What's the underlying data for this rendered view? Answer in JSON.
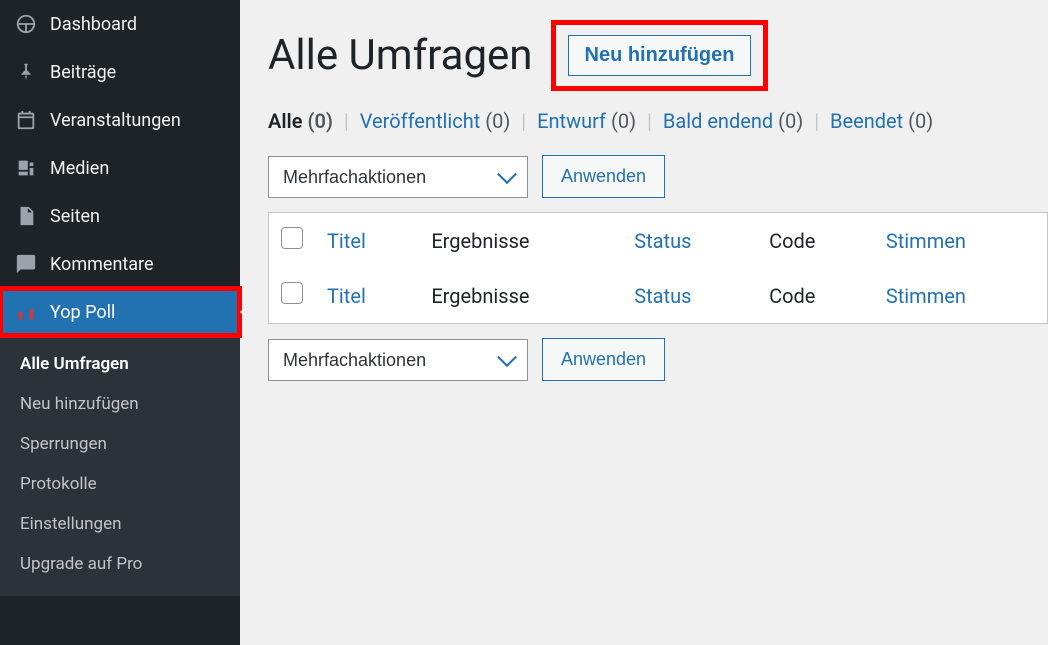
{
  "sidebar": {
    "items": [
      {
        "id": "dashboard",
        "label": "Dashboard"
      },
      {
        "id": "posts",
        "label": "Beiträge"
      },
      {
        "id": "events",
        "label": "Veranstaltungen"
      },
      {
        "id": "media",
        "label": "Medien"
      },
      {
        "id": "pages",
        "label": "Seiten"
      },
      {
        "id": "comments",
        "label": "Kommentare"
      },
      {
        "id": "yop-poll",
        "label": "Yop Poll"
      }
    ],
    "submenu": [
      {
        "id": "all-polls",
        "label": "Alle Umfragen",
        "current": true
      },
      {
        "id": "add-new",
        "label": "Neu hinzufügen"
      },
      {
        "id": "bans",
        "label": "Sperrungen"
      },
      {
        "id": "logs",
        "label": "Protokolle"
      },
      {
        "id": "settings",
        "label": "Einstellungen"
      },
      {
        "id": "upgrade",
        "label": "Upgrade auf Pro"
      }
    ]
  },
  "header": {
    "title": "Alle Umfragen",
    "add_new": "Neu hinzufügen"
  },
  "filters": {
    "all": {
      "label": "Alle",
      "count": "(0)"
    },
    "published": {
      "label": "Veröffentlicht",
      "count": "(0)"
    },
    "draft": {
      "label": "Entwurf",
      "count": "(0)"
    },
    "ending": {
      "label": "Bald endend",
      "count": "(0)"
    },
    "ended": {
      "label": "Beendet",
      "count": "(0)"
    }
  },
  "bulk": {
    "placeholder": "Mehrfachaktionen",
    "apply": "Anwenden"
  },
  "table": {
    "columns": {
      "title": "Titel",
      "results": "Ergebnisse",
      "status": "Status",
      "code": "Code",
      "votes": "Stimmen"
    }
  }
}
